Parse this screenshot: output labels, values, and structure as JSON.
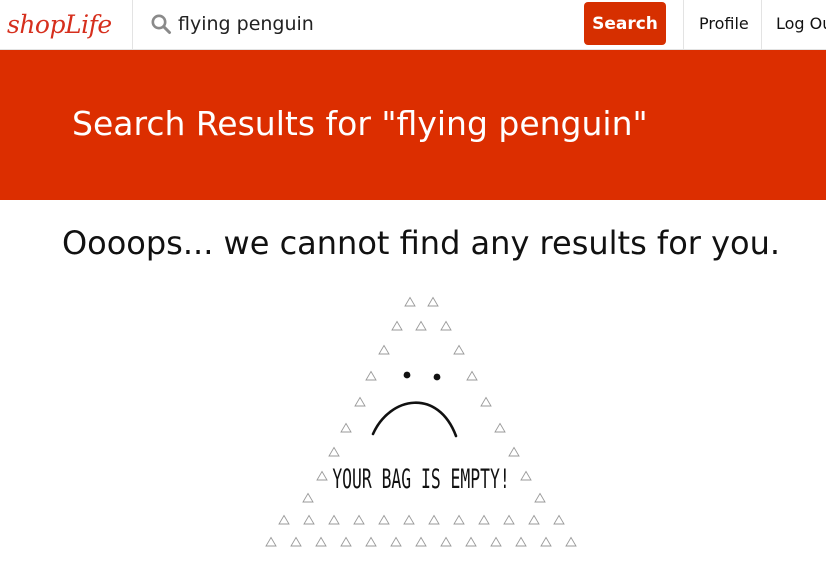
{
  "header": {
    "logo_text": "shopLife",
    "search": {
      "value": "flying penguin",
      "placeholder": "",
      "button_label": "Search"
    },
    "nav": {
      "profile_label": "Profile",
      "logout_label": "Log Out"
    }
  },
  "banner": {
    "title": "Search Results for \"flying penguin\""
  },
  "main": {
    "empty_message": "Oooops... we cannot find any results for you.",
    "illustration_caption": "YOUR BAG IS EMPTY!"
  },
  "colors": {
    "brand_red": "#dc2e00",
    "logo_red": "#d62f1d",
    "triangle_grey": "#9a9a9a"
  },
  "icons": {
    "search": "search-icon",
    "pattern_marker": "triangle-outline-icon"
  }
}
